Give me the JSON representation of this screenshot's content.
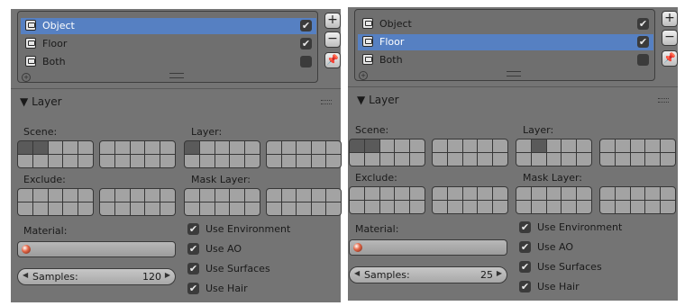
{
  "panels": [
    {
      "render_layers": [
        {
          "name": "Object",
          "checked": true,
          "selected": true
        },
        {
          "name": "Floor",
          "checked": true,
          "selected": false
        },
        {
          "name": "Both",
          "checked": false,
          "selected": false
        }
      ],
      "layer_section": {
        "title": "Layer",
        "scene_label": "Scene:",
        "layer_label": "Layer:",
        "exclude_label": "Exclude:",
        "mask_layer_label": "Mask Layer:",
        "material_label": "Material:",
        "samples_label": "Samples:",
        "samples_value": "120",
        "options": [
          {
            "label": "Use Environment",
            "checked": true
          },
          {
            "label": "Use AO",
            "checked": true
          },
          {
            "label": "Use Surfaces",
            "checked": true
          },
          {
            "label": "Use Hair",
            "checked": true
          }
        ]
      }
    },
    {
      "render_layers": [
        {
          "name": "Object",
          "checked": true,
          "selected": false
        },
        {
          "name": "Floor",
          "checked": true,
          "selected": true
        },
        {
          "name": "Both",
          "checked": false,
          "selected": false
        }
      ],
      "layer_section": {
        "title": "Layer",
        "scene_label": "Scene:",
        "layer_label": "Layer:",
        "exclude_label": "Exclude:",
        "mask_layer_label": "Mask Layer:",
        "material_label": "Material:",
        "samples_label": "Samples:",
        "samples_value": "25",
        "options": [
          {
            "label": "Use Environment",
            "checked": true
          },
          {
            "label": "Use AO",
            "checked": true
          },
          {
            "label": "Use Surfaces",
            "checked": true
          },
          {
            "label": "Use Hair",
            "checked": true
          }
        ]
      }
    }
  ],
  "icons": {
    "render_layer": "render-layer-icon",
    "add": "+",
    "remove": "−",
    "pin": "pin-icon",
    "check": "✔",
    "material": "material-sphere-icon"
  }
}
